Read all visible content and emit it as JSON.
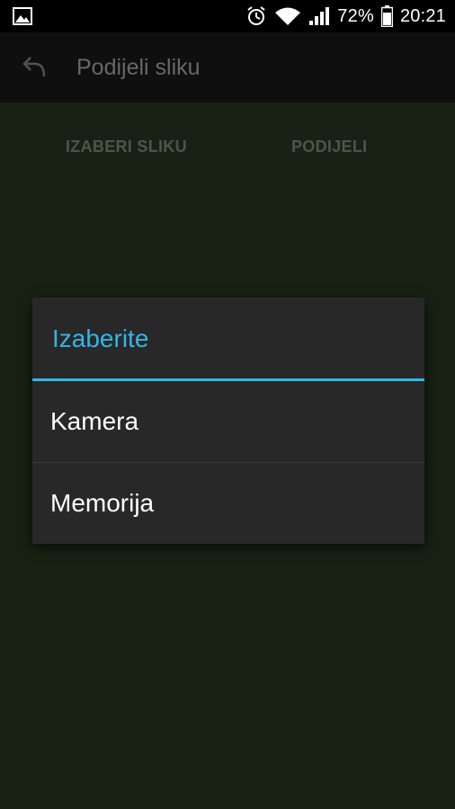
{
  "status_bar": {
    "icons": [
      "image-icon",
      "alarm-icon",
      "wifi-icon",
      "signal-icon",
      "battery-icon"
    ],
    "battery_percent": "72%",
    "time": "20:21"
  },
  "action_bar": {
    "back_icon": "back-arrow-icon",
    "title": "Podijeli sliku"
  },
  "tabs": {
    "choose_label": "IZABERI SLIKU",
    "share_label": "PODIJELI"
  },
  "dialog": {
    "title": "Izaberite",
    "options": [
      {
        "label": "Kamera"
      },
      {
        "label": "Memorija"
      }
    ]
  },
  "colors": {
    "accent": "#33b5e5",
    "background": "#1f2e1b",
    "dialog": "#282828"
  }
}
